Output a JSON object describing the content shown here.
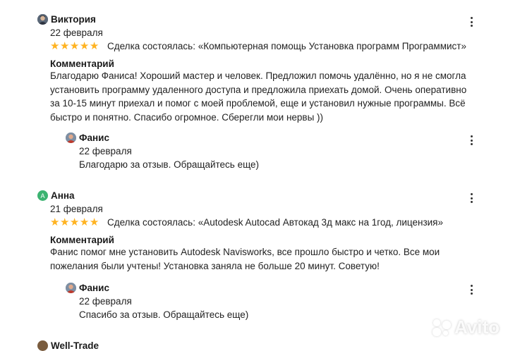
{
  "reviews": [
    {
      "author": "Виктория",
      "date": "22 февраля",
      "rating": 5,
      "deal": "Сделка состоялась: «Компьютерная помощь Установка программ Программист»",
      "comment_heading": "Комментарий",
      "comment_lines": [
        "Благодарю Фаниса! Хороший мастер и человек. Предложил помочь удалённо, но я не смогла",
        "установить программу удаленного доступа и предложила приехать домой. Очень оперативно",
        "за 10-15 минут приехал и помог с моей проблемой, еще и установил нужные программы. Всё",
        "быстро и понятно. Спасибо огромное. Сберегли мои нервы ))"
      ],
      "reply": {
        "author": "Фанис",
        "date": "22 февраля",
        "text": "Благодарю за отзыв. Обращайтесь еще)"
      }
    },
    {
      "author": "Анна",
      "avatar_letter": "А",
      "date": "21 февраля",
      "rating": 5,
      "deal": "Сделка состоялась: «Autodesk Autocad Автокад 3д макс на 1год, лицензия»",
      "comment_heading": "Комментарий",
      "comment_lines": [
        "Фанис помог мне установить Autodesk Navisworks, все прошло быстро и четко. Все мои",
        "пожелания были учтены! Установка заняла не больше 20 минут. Советую!"
      ],
      "reply": {
        "author": "Фанис",
        "date": "22 февраля",
        "text": "Спасибо за отзыв. Обращайтесь еще)"
      }
    },
    {
      "author": "Well-Trade"
    }
  ],
  "watermark": "Avito",
  "colors": {
    "star": "#ffb321",
    "avatar_anna": "#3cb371",
    "text": "#222222"
  },
  "icons": {
    "menu": "kebab-menu-icon",
    "star": "star-icon"
  }
}
